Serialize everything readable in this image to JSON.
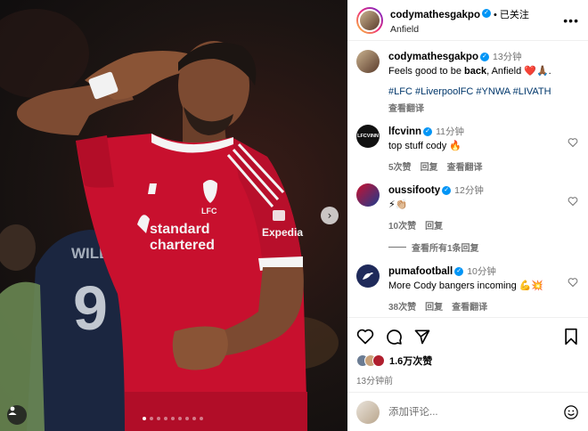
{
  "photo": {
    "jersey": {
      "sponsor_line1": "standard",
      "sponsor_line2": "chartered",
      "sleeve_sponsor": "Expedia",
      "crest": "LFC",
      "opponent_name": "WILLIAN",
      "opponent_number": "9"
    },
    "carousel": {
      "count": 9,
      "active": 0
    },
    "icons": {
      "next": "chevron-right-icon",
      "tagged": "user-tag-icon"
    }
  },
  "post": {
    "author": "codymathesgakpo",
    "follow_state": "已关注",
    "location": "Anfield",
    "caption": {
      "author": "codymathesgakpo",
      "time": "13分钟",
      "text_before": "Feels good to be ",
      "text_bold": "back",
      "text_after": ", Anfield ❤️🙏🏾.",
      "hashtags": "#LFC #LiverpoolFC #YNWA #LIVATH",
      "translate": "查看翻译"
    },
    "comments": [
      {
        "user": "lfcvinn",
        "time": "11分钟",
        "text": "top stuff cody 🔥",
        "likes": "5次赞",
        "reply": "回复",
        "translate": "查看翻译",
        "avatar_color": "#111111",
        "avatar_label": "LFCVINN"
      },
      {
        "user": "oussifooty",
        "time": "12分钟",
        "text": "⚡👏🏼",
        "likes": "10次赞",
        "reply": "回复",
        "avatar_color": "#c8102e",
        "view_replies": "查看所有1条回复"
      },
      {
        "user": "pumafootball",
        "time": "10分钟",
        "text": "More Cody bangers incoming 💪💥",
        "likes": "38次赞",
        "reply": "回复",
        "translate": "查看翻译",
        "avatar_color": "#1f2a5a"
      }
    ],
    "likes_count": "1.6万次赞",
    "posted_ago": "13分钟前",
    "composer_placeholder": "添加评论...",
    "colors": {
      "verified": "#0095f6",
      "hashtag": "#00376b",
      "muted": "#737373",
      "kit_red": "#c8102e"
    }
  }
}
